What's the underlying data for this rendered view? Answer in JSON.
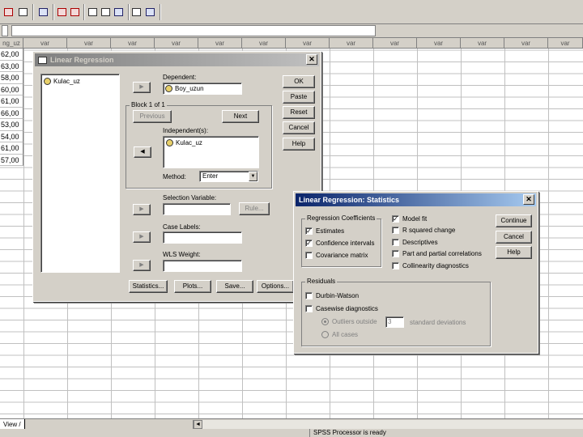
{
  "spreadsheet": {
    "column_headers": [
      "ng_uz",
      "var",
      "var",
      "var",
      "var",
      "var",
      "var",
      "var",
      "var",
      "var",
      "var",
      "var",
      "var",
      "var"
    ],
    "row_values": [
      "62,00",
      "63,00",
      "58,00",
      "60,00",
      "61,00",
      "66,00",
      "53,00",
      "54,00",
      "61,00",
      "57,00"
    ],
    "sheet_tab": "View /",
    "status_text": "SPSS Processor  is ready"
  },
  "linear_regression_dialog": {
    "title": "Linear Regression",
    "variables": [
      "Kulac_uz"
    ],
    "dependent_label": "Dependent:",
    "dependent_value": "Boy_uzun",
    "block_label": "Block 1 of 1",
    "previous_label": "Previous",
    "next_label": "Next",
    "independents_label": "Independent(s):",
    "independents": [
      "Kulac_uz"
    ],
    "method_label": "Method:",
    "method_value": "Enter",
    "selection_variable_label": "Selection Variable:",
    "rule_label": "Rule...",
    "case_labels_label": "Case Labels:",
    "wls_weight_label": "WLS Weight:",
    "buttons": {
      "ok": "OK",
      "paste": "Paste",
      "reset": "Reset",
      "cancel": "Cancel",
      "help": "Help"
    },
    "bottom_buttons": {
      "statistics": "Statistics...",
      "plots": "Plots...",
      "save": "Save...",
      "options": "Options..."
    }
  },
  "statistics_dialog": {
    "title": "Linear Regression: Statistics",
    "coefficients_group": "Regression Coefficients",
    "coefficients": [
      {
        "label": "Estimates",
        "checked": true
      },
      {
        "label": "Confidence intervals",
        "checked": true
      },
      {
        "label": "Covariance matrix",
        "checked": false
      }
    ],
    "options": [
      {
        "label": "Model fit",
        "checked": true
      },
      {
        "label": "R squared change",
        "checked": false
      },
      {
        "label": "Descriptives",
        "checked": false
      },
      {
        "label": "Part and partial correlations",
        "checked": false
      },
      {
        "label": "Collinearity diagnostics",
        "checked": false
      }
    ],
    "buttons": {
      "continue": "Continue",
      "cancel": "Cancel",
      "help": "Help"
    },
    "residuals_group": "Residuals",
    "durbin_watson": {
      "label": "Durbin-Watson",
      "checked": false
    },
    "casewise": {
      "label": "Casewise diagnostics",
      "checked": false
    },
    "outliers_label": "Outliers outside",
    "outliers_value": "3",
    "std_dev_label": "standard deviations",
    "all_cases_label": "All cases"
  }
}
